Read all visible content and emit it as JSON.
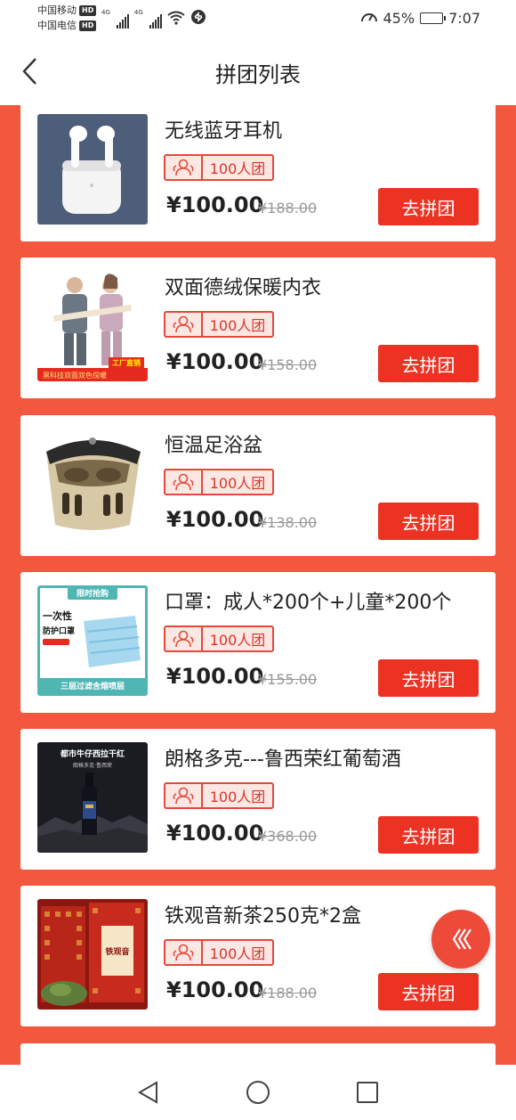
{
  "status_bar": {
    "carrier1": "中国移动",
    "carrier2": "中国电信",
    "hd": "HD",
    "net1": "4G",
    "net2": "4G",
    "battery": "45%",
    "time": "7:07",
    "battery_level": 0.45
  },
  "header": {
    "title": "拼团列表"
  },
  "items": [
    {
      "title": "无线蓝牙耳机",
      "group": "100人团",
      "price": "¥100.00",
      "original_price": "¥188.00",
      "button": "去拼团"
    },
    {
      "title": "双面德绒保暖内衣",
      "group": "100人团",
      "price": "¥100.00",
      "original_price": "¥158.00",
      "button": "去拼团"
    },
    {
      "title": "恒温足浴盆",
      "group": "100人团",
      "price": "¥100.00",
      "original_price": "¥138.00",
      "button": "去拼团"
    },
    {
      "title": "口罩：成人*200个+儿童*200个",
      "group": "100人团",
      "price": "¥100.00",
      "original_price": "¥155.00",
      "button": "去拼团"
    },
    {
      "title": "朗格多克---鲁西荣红葡萄酒",
      "group": "100人团",
      "price": "¥100.00",
      "original_price": "¥368.00",
      "button": "去拼团"
    },
    {
      "title": "铁观音新茶250克*2盒",
      "group": "100人团",
      "price": "¥100.00",
      "original_price": "¥188.00",
      "button": "去拼团"
    }
  ],
  "product_images": {
    "underwear_badge": "工厂直销",
    "underwear_banner": "黑科技双面双色保暖",
    "mask_tag": "限时抢购",
    "mask_line1": "一次性",
    "mask_line2": "防护口罩",
    "mask_bottom": "三层过滤含熔喷层",
    "wine_title": "都市牛仔西拉干红",
    "wine_sub": "朗格多克·鲁西荣",
    "tea_label": "铁观音"
  },
  "icons": {
    "back": "chevron-left-icon",
    "group": "group-people-icon",
    "float": "double-chevron-left-icon",
    "nav_back": "triangle-back-icon",
    "nav_home": "circle-home-icon",
    "nav_recent": "square-recent-icon"
  },
  "colors": {
    "accent": "#ec3223",
    "background": "#f3573d",
    "badge_bg": "#fde7e3"
  }
}
